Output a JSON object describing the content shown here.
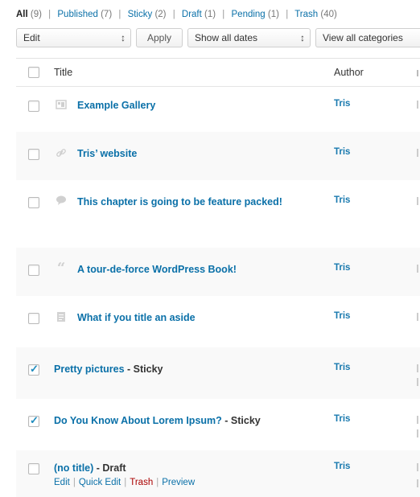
{
  "status_filters": [
    {
      "label": "All",
      "count": "(9)"
    },
    {
      "label": "Published",
      "count": "(7)"
    },
    {
      "label": "Sticky",
      "count": "(2)"
    },
    {
      "label": "Draft",
      "count": "(1)"
    },
    {
      "label": "Pending",
      "count": "(1)"
    },
    {
      "label": "Trash",
      "count": "(40)"
    }
  ],
  "tablenav": {
    "bulk_action_value": "Edit",
    "apply_label": "Apply",
    "dates_value": "Show all dates",
    "categories_value": "View all categories"
  },
  "table": {
    "headers": {
      "title": "Title",
      "author": "Author"
    },
    "rows": [
      {
        "title": "Example Gallery",
        "state": "",
        "author": "Tris",
        "format_icon": "gallery-icon",
        "checked": false
      },
      {
        "title": "Tris’ website",
        "state": "",
        "author": "Tris",
        "format_icon": "link-icon",
        "checked": false
      },
      {
        "title": "This chapter is going to be feature packed!",
        "state": "",
        "author": "Tris",
        "format_icon": "chat-icon",
        "checked": false
      },
      {
        "title": "A tour-de-force WordPress Book!",
        "state": "",
        "author": "Tris",
        "format_icon": "quote-icon",
        "checked": false
      },
      {
        "title": "What if you title an aside",
        "state": "",
        "author": "Tris",
        "format_icon": "aside-icon",
        "checked": false
      },
      {
        "title": "Pretty pictures",
        "state": " - Sticky",
        "author": "Tris",
        "format_icon": "",
        "checked": true
      },
      {
        "title": "Do You Know About Lorem Ipsum?",
        "state": " - Sticky",
        "author": "Tris",
        "format_icon": "",
        "checked": true
      },
      {
        "title": "(no title)",
        "state": " - Draft",
        "author": "Tris",
        "format_icon": "",
        "checked": false
      }
    ],
    "row_actions": {
      "edit": "Edit",
      "quick_edit": "Quick Edit",
      "trash": "Trash",
      "preview": "Preview"
    }
  },
  "colors": {
    "link": "#0a70a8",
    "trash": "#aa0000",
    "check": "#1e8cbe"
  }
}
